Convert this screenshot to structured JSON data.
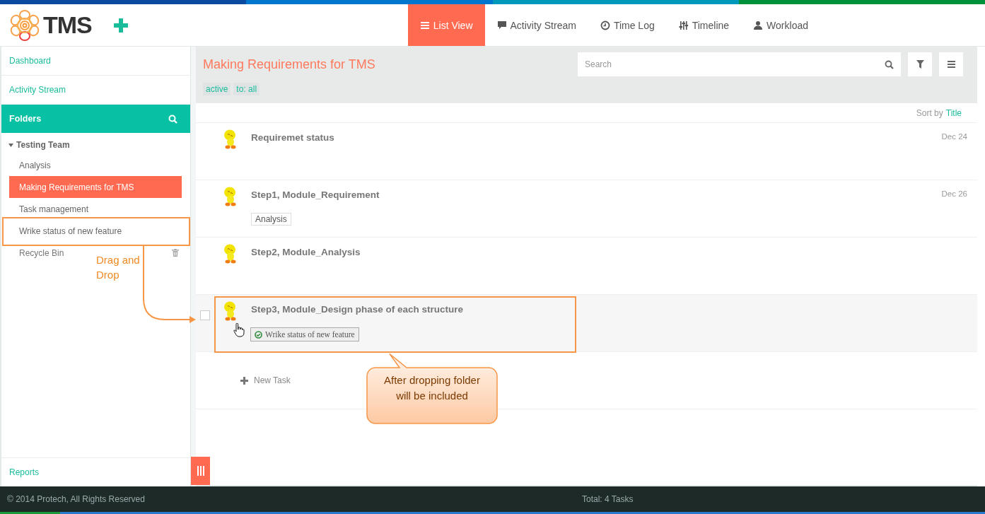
{
  "header": {
    "logo": "TMS",
    "nav_tabs": [
      {
        "label": "List View",
        "kind": "list",
        "selected": true
      },
      {
        "label": "Activity Stream",
        "kind": "comment",
        "selected": false
      },
      {
        "label": "Time Log",
        "kind": "clock",
        "selected": false
      },
      {
        "label": "Timeline",
        "kind": "sliders",
        "selected": false
      },
      {
        "label": "Workload",
        "kind": "user",
        "selected": false
      }
    ]
  },
  "sidebar": {
    "links": [
      {
        "label": "Dashboard"
      },
      {
        "label": "Activity Stream"
      }
    ],
    "folders_title": "Folders",
    "tree": {
      "label": "Testing Team",
      "expanded": true,
      "children": [
        {
          "label": "Analysis",
          "selected": false
        },
        {
          "label": "Making Requirements for TMS",
          "selected": true
        },
        {
          "label": "Task management",
          "selected": false
        },
        {
          "label": "Wrike status of new feature",
          "selected": false
        }
      ]
    },
    "recycle_bin": "Recycle Bin",
    "reports": "Reports"
  },
  "main": {
    "title": "Making Requirements for TMS",
    "search": {
      "placeholder": "Search"
    },
    "filters": [
      "active",
      "to: all"
    ],
    "sort_label": "Sort by",
    "sort_value": "Title",
    "tasks": [
      {
        "title": "Requiremet status",
        "date": "Dec 24",
        "hovered": false
      },
      {
        "title": "Step1, Module_Requirement",
        "date": "Dec 26",
        "hovered": false,
        "tags": [
          {
            "label": "Analysis",
            "kind": "plain"
          }
        ]
      },
      {
        "title": "Step2, Module_Analysis",
        "hovered": false
      },
      {
        "title": "Step3, Module_Design phase of each structure",
        "hovered": true,
        "checked": false,
        "tags": [
          {
            "label": "Wrike status of new feature",
            "kind": "dropped"
          }
        ]
      }
    ],
    "new_task": "New Task"
  },
  "footer": {
    "copyright": "© 2014 Protech, All Rights Reserved",
    "total": "Total: 4 Tasks"
  },
  "annotations": {
    "drag_label": "Drag and Drop",
    "callout": "After dropping folder will be included"
  }
}
